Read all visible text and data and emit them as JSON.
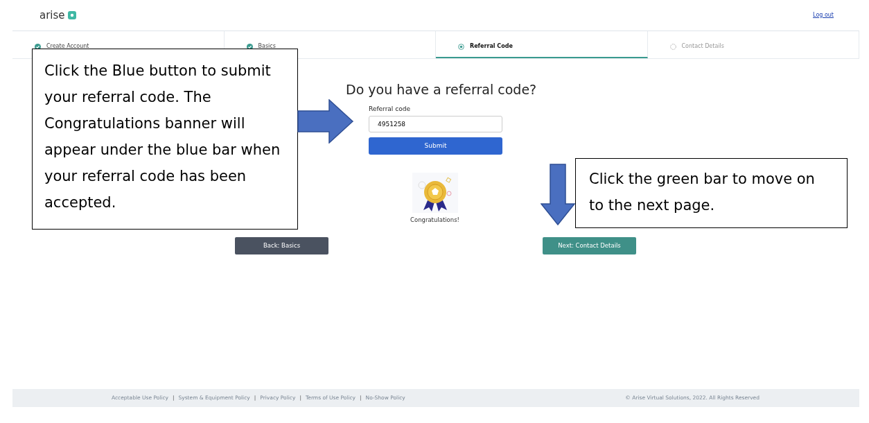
{
  "header": {
    "logo": "arise",
    "logout_link": "Log out"
  },
  "steps": [
    {
      "label": "Create Account",
      "completed": true,
      "selected": false
    },
    {
      "label": "Basics",
      "completed": true,
      "selected": false
    },
    {
      "label": "Referral Code",
      "completed": false,
      "selected": true
    },
    {
      "label": "Contact Details",
      "completed": false,
      "selected": false
    }
  ],
  "form": {
    "title": "Do you have a referral code?",
    "field_label": "Referral code",
    "value": "4951258",
    "submit_button": "Submit",
    "banner_text": "Congratulations!"
  },
  "buttons": [
    {
      "label": "Back: Basics",
      "kind": "back"
    },
    {
      "label": "Next: Contact Details",
      "kind": "next"
    }
  ],
  "callouts": [
    {
      "text": "Click the Blue button to submit your referral code. The Congratulations banner will appear under the blue bar when your referral code has been accepted.",
      "kind": "right"
    },
    {
      "text": "Click the green bar to move on to the next page.",
      "kind": "down"
    }
  ],
  "footer": {
    "links": [
      {
        "label": "Acceptable Use Policy",
        "separator": "|"
      },
      {
        "label": "System & Equipment Policy",
        "separator": "|"
      },
      {
        "label": "Privacy Policy",
        "separator": "|"
      },
      {
        "label": "Terms of Use Policy",
        "separator": "|"
      },
      {
        "label": "No-Show Policy"
      }
    ],
    "copyright": "© Arise Virtual Solutions, 2022. All Rights Reserved"
  }
}
